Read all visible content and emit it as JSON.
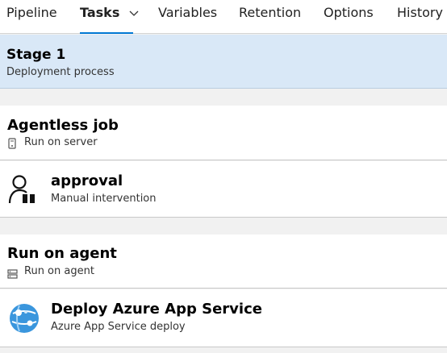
{
  "tabs": [
    {
      "label": "Pipeline",
      "active": false
    },
    {
      "label": "Tasks",
      "active": true
    },
    {
      "label": "Variables",
      "active": false
    },
    {
      "label": "Retention",
      "active": false
    },
    {
      "label": "Options",
      "active": false
    },
    {
      "label": "History",
      "active": false
    }
  ],
  "stage": {
    "title": "Stage 1",
    "subtitle": "Deployment process"
  },
  "jobs": [
    {
      "title": "Agentless job",
      "subtitle": "Run on server",
      "icon": "server-icon",
      "tasks": [
        {
          "title": "approval",
          "subtitle": "Manual intervention",
          "icon": "manual-intervention-icon"
        }
      ]
    },
    {
      "title": "Run on agent",
      "subtitle": "Run on agent",
      "icon": "agent-icon",
      "tasks": [
        {
          "title": "Deploy Azure App Service",
          "subtitle": "Azure App Service deploy",
          "icon": "azure-app-service-icon"
        }
      ]
    }
  ],
  "colors": {
    "accent": "#0078d4",
    "stage_background": "#d9e8f7",
    "page_background": "#f1f1f1"
  }
}
